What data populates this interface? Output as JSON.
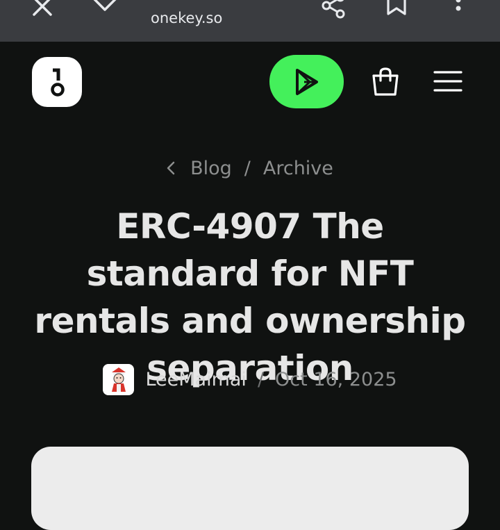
{
  "browser": {
    "url": "onekey.so",
    "icons": [
      "close-icon",
      "chevron-down-icon",
      "share-icon",
      "bookmark-icon",
      "more-vert-icon"
    ]
  },
  "header": {
    "logo_text": "1 0",
    "play_icon": "google-play-icon",
    "cart_icon": "shopping-bag-icon",
    "menu_icon": "hamburger-menu-icon",
    "accent_color": "#44f05b"
  },
  "breadcrumb": {
    "items": [
      "Blog",
      "Archive"
    ],
    "separator": "/"
  },
  "article": {
    "title": "ERC-4907 The standard for NFT rentals and ownership separation",
    "author": "LeeMaimai",
    "separator": "/",
    "date": "Oct 16, 2025"
  },
  "colors": {
    "background": "#101211",
    "browser_bar": "#3a3c40",
    "title_text": "#e6e6e6",
    "muted_text": "#8d8f8f"
  }
}
